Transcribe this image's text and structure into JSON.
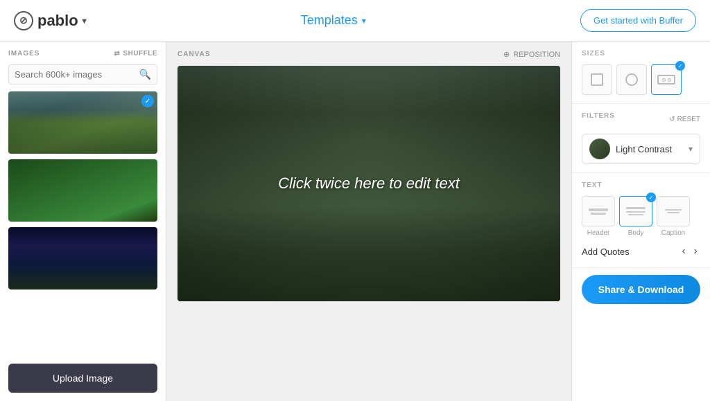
{
  "header": {
    "logo_text": "pablo",
    "templates_label": "Templates",
    "get_started_label": "Get started with Buffer"
  },
  "left_panel": {
    "images_label": "IMAGES",
    "shuffle_label": "SHUFFLE",
    "search_placeholder": "Search 600k+ images",
    "upload_label": "Upload Image"
  },
  "canvas": {
    "label": "CANVAS",
    "reposition_label": "REPOSITION",
    "edit_text": "Click twice here to edit text"
  },
  "right_panel": {
    "sizes_label": "SIZES",
    "filters_label": "FILTERS",
    "reset_label": "RESET",
    "filter_name": "Light Contrast",
    "text_label": "TEXT",
    "header_label": "Header",
    "body_label": "Body",
    "caption_label": "Caption",
    "add_quotes_label": "Add Quotes",
    "share_label": "Share & Download"
  }
}
